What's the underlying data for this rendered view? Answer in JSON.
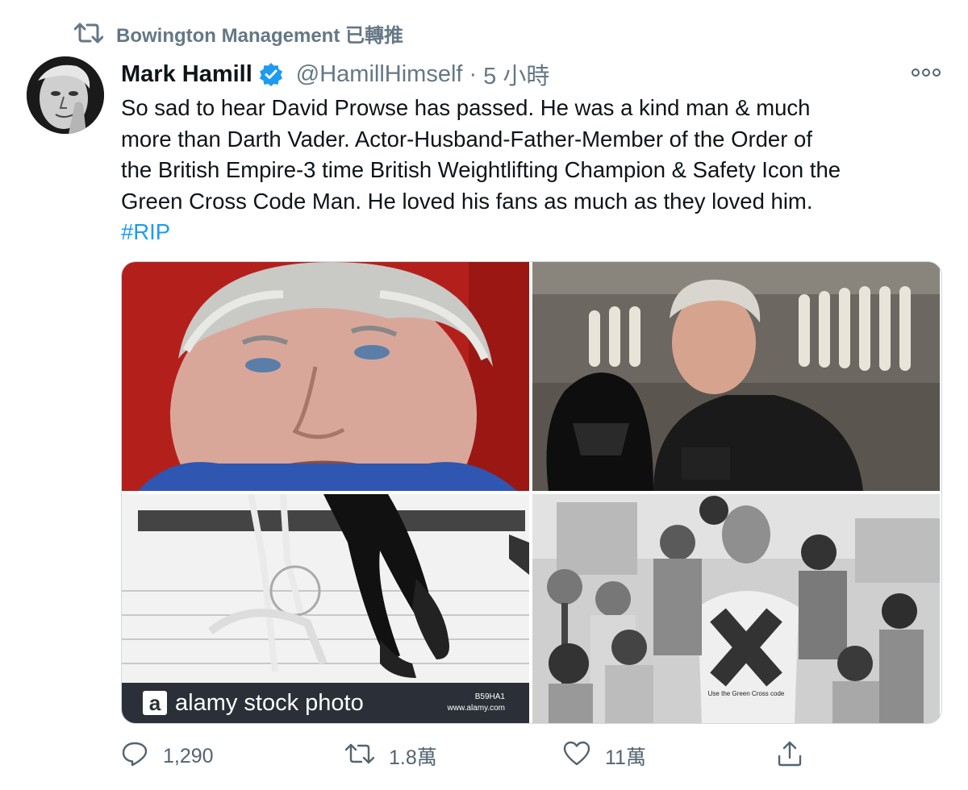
{
  "retweet_banner": {
    "icon": "retweet-icon",
    "text": "Bowington Management 已轉推"
  },
  "tweet": {
    "author_name": "Mark Hamill",
    "verified_icon": "verified-badge-icon",
    "handle": "@HamillHimself",
    "separator": "·",
    "time": "5 小時",
    "more_icon": "more-options-icon",
    "text": "So sad to hear David Prowse has passed. He was a kind man & much\nmore than Darth Vader. Actor-Husband-Father-Member of the Order of\nthe British Empire-3 time British Weightlifting Champion & Safety Icon the\nGreen Cross Code Man. He loved his fans as much as they loved him.",
    "hashtag": "#RIP"
  },
  "media": {
    "watermark_logo": "a",
    "watermark_text": "alamy stock photo",
    "watermark_id": "B59HA1",
    "watermark_url": "www.alamy.com",
    "shirt_text": "Use the Green Cross code"
  },
  "actions": {
    "reply_count": "1,290",
    "retweet_count": "1.8萬",
    "like_count": "11萬"
  },
  "colors": {
    "accent": "#1d9bf0",
    "muted": "#657786",
    "text": "#0f1419"
  }
}
